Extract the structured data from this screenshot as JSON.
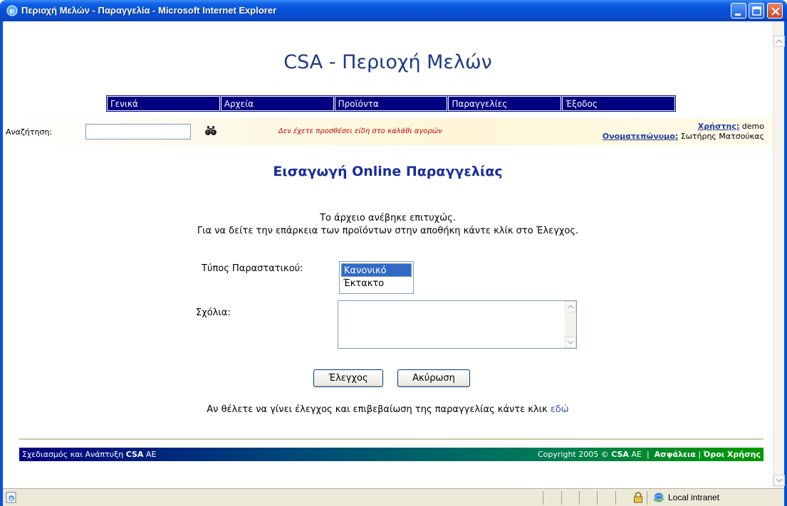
{
  "window": {
    "title": "Περιοχή Μελών - Παραγγελία - Microsoft Internet Explorer"
  },
  "site": {
    "title": "CSA - Περιοχή Μελών"
  },
  "nav": {
    "items": [
      "Γενικά",
      "Αρχεία",
      "Προϊόντα",
      "Παραγγελίες",
      "Έξοδος"
    ]
  },
  "search": {
    "label": "Αναζήτηση:",
    "value": ""
  },
  "cart": {
    "message": "Δεν έχετε προσθέσει είδη στο καλάθι αγορών"
  },
  "user": {
    "user_label": "Χρήστης:",
    "user_value": "demo",
    "name_label": "Ονοματεπώνυμο:",
    "name_value": "Σωτήρης Ματσούκας"
  },
  "page": {
    "heading": "Εισαγωγή Online Παραγγελίας",
    "upload_msg": "Το άρχειο ανέβηκε επιτυχώς.",
    "check_msg": "Για να δείτε την επάρκεια των προϊόντων στην αποθήκη κάντε κλίκ στο Έλεγχος."
  },
  "form": {
    "doc_type_label": "Τύπος Παραστατικού:",
    "doc_type_options": [
      "Κανονικό",
      "Έκτακτο"
    ],
    "doc_type_selected": "Κανονικό",
    "comments_label": "Σχόλια:",
    "comments_value": ""
  },
  "buttons": {
    "check": "Έλεγχος",
    "cancel": "Ακύρωση"
  },
  "confirm": {
    "text": "Αν θέλετε να γίνει έλεγχος και επιβεβαίωση της παραγγελίας κάντε κλικ",
    "link": "εδώ"
  },
  "footer": {
    "design_prefix": "Σχεδιασμός και Ανάπτυξη",
    "design_company": "CSA",
    "design_suffix": "AE",
    "copyright_prefix": "Copyright 2005 ©",
    "copyright_company": "CSA",
    "copyright_suffix": "AE",
    "security": "Ασφάλεια",
    "terms": "Όροι Χρήσης",
    "separator": "|"
  },
  "statusbar": {
    "zone": "Local intranet"
  },
  "colors": {
    "nav_bg": "#000080",
    "heading": "#1a2e9a",
    "cart_msg": "#c00000",
    "link": "#3a4fc0"
  }
}
